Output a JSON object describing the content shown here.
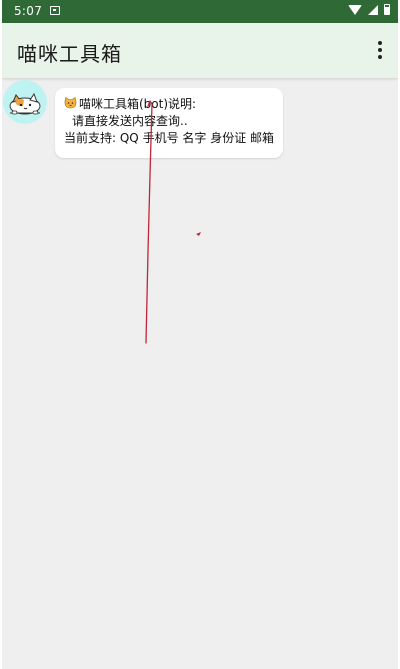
{
  "statusbar": {
    "time": "5:07"
  },
  "appbar": {
    "title": "喵咪工具箱"
  },
  "chat": {
    "messages": [
      {
        "line1": "喵咪工具箱(bot)说明:",
        "line2": "请直接发送内容查询..",
        "line3": "当前支持: QQ 手机号 名字 身份证 邮箱"
      }
    ]
  },
  "colors": {
    "statusbar": "#2f6a36",
    "appbar": "#e8f3e9",
    "background": "#efefef",
    "avatar_bg": "#bff3f1",
    "scribble": "#c0263a"
  },
  "icons": [
    "notification-icon",
    "wifi-icon",
    "signal-icon",
    "battery-icon",
    "more-vert-icon",
    "cat-emoji-icon"
  ]
}
